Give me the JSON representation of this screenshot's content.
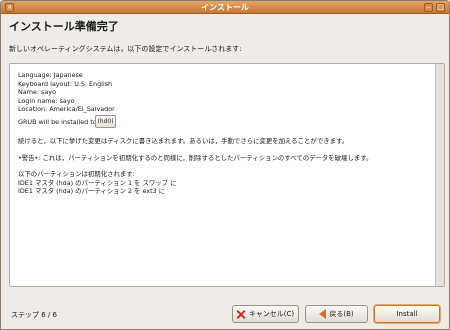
{
  "window": {
    "title": "インストール"
  },
  "heading": "インストール準備完了",
  "instruction": "新しいオペレーティングシステムは，以下の設定でインストールされます:",
  "summary": {
    "lines": [
      "Language: Japanese",
      "Keyboard layout: U.S. English",
      "Name: sayo",
      "Login name: sayo",
      "Location: America/El_Salvador"
    ],
    "grub_text": "GRUB will be installed to",
    "grub_button": "(hd0)",
    "continue_note": "続けると，以下に挙げた変更はディスクに書き込まれます。あるいは，手動でさらに変更を加えることができます。",
    "warning": "•警告•: これは，パーティションを初期化するのと同様に，削除するとしたパーティションのすべてのデータを破壊します。",
    "partitions_heading": "以下のパーティションは初期化されます:",
    "partitions": [
      "IDE1 マスタ (hda) のパーティション 1 を スワップ に",
      "IDE1 マスタ (hda) のパーティション 2 を ext3 に"
    ]
  },
  "footer": {
    "step": "ステップ 6 / 6",
    "cancel_label": "キャンセル(C)",
    "back_label": "戻る(B)",
    "install_label": "Install"
  },
  "icons": {
    "cancel": "close-icon",
    "back": "back-arrow-icon"
  }
}
